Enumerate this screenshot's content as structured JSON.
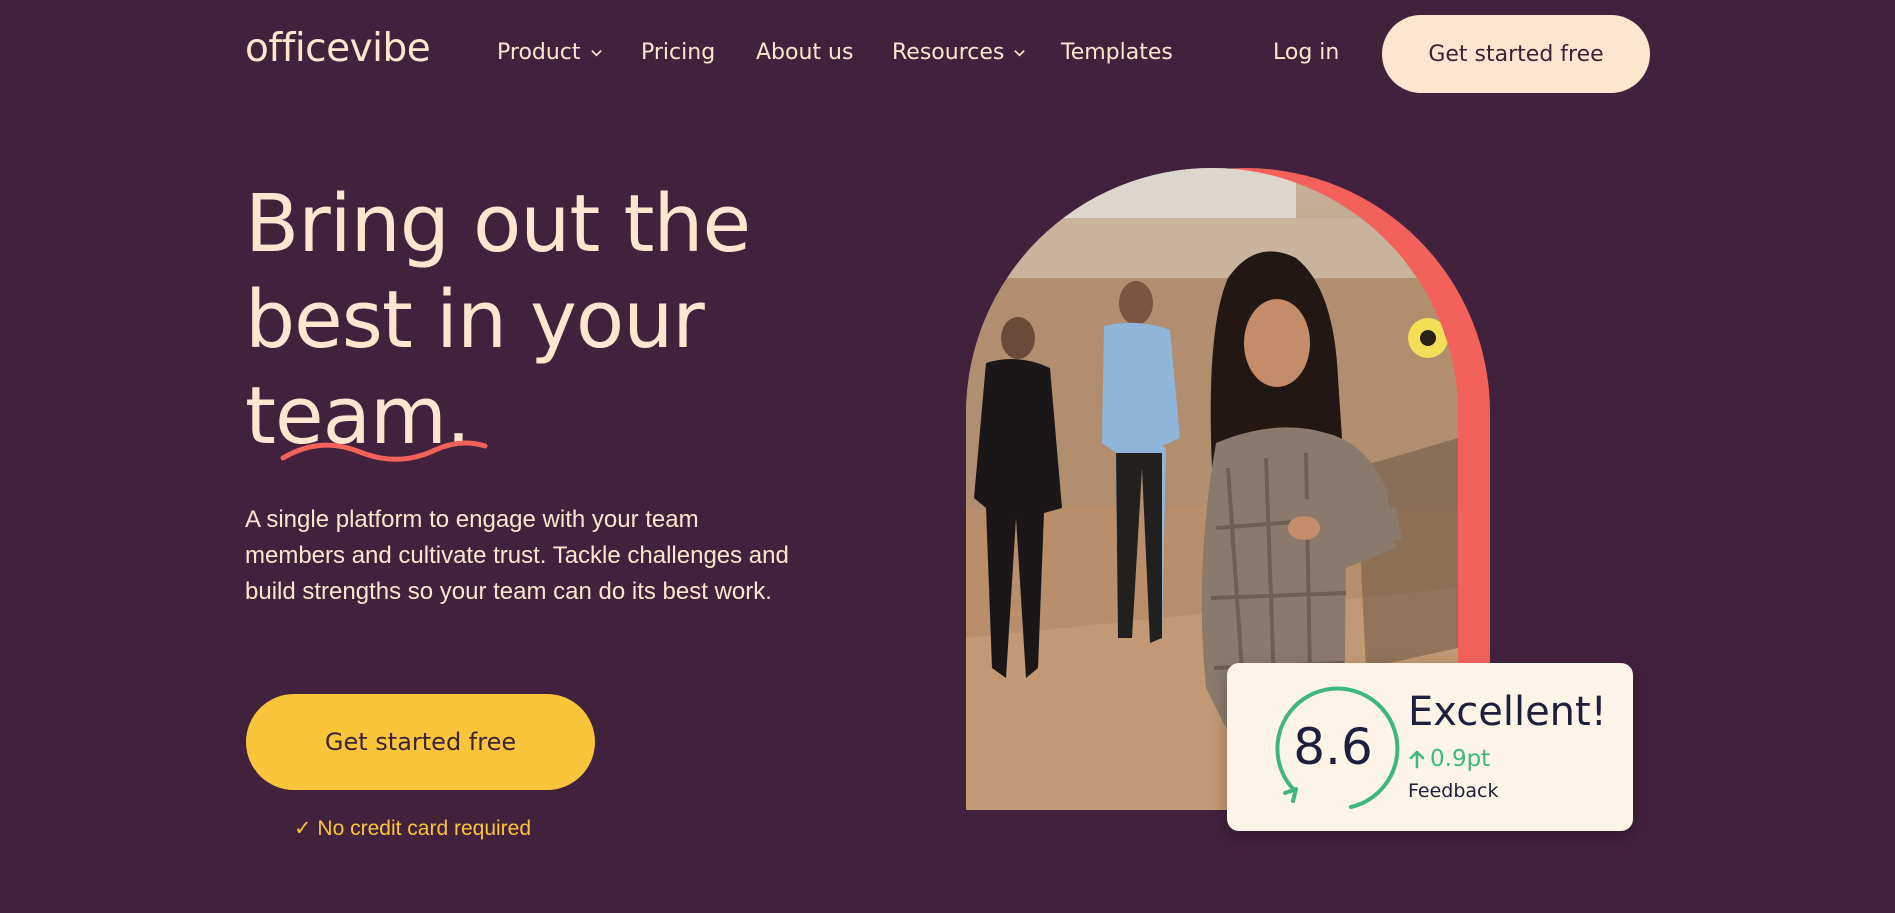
{
  "header": {
    "logo": "officevibe",
    "nav": [
      {
        "label": "Product",
        "dropdown": true
      },
      {
        "label": "Pricing",
        "dropdown": false
      },
      {
        "label": "About us",
        "dropdown": false
      },
      {
        "label": "Resources",
        "dropdown": true
      },
      {
        "label": "Templates",
        "dropdown": false
      }
    ],
    "login_label": "Log in",
    "cta_label": "Get started free"
  },
  "hero": {
    "title_lines": [
      "Bring out the",
      "best in your",
      "team."
    ],
    "subtitle": "A single platform to engage with your team members and cultivate trust. Tackle challenges and build strengths so your team can do its best work.",
    "cta_label": "Get started free",
    "note": "✓ No credit card required"
  },
  "score_card": {
    "score": "8.6",
    "rating": "Excellent!",
    "delta": "0.9pt",
    "metric": "Feedback"
  },
  "colors": {
    "background": "#42213c",
    "cream": "#fde6cf",
    "yellow": "#f9c63b",
    "coral": "#f2625a",
    "green": "#3cb87a",
    "navy": "#1d1f3d"
  },
  "icons": [
    "chevron-down-icon",
    "arrow-up-icon",
    "refresh-ring-icon"
  ]
}
